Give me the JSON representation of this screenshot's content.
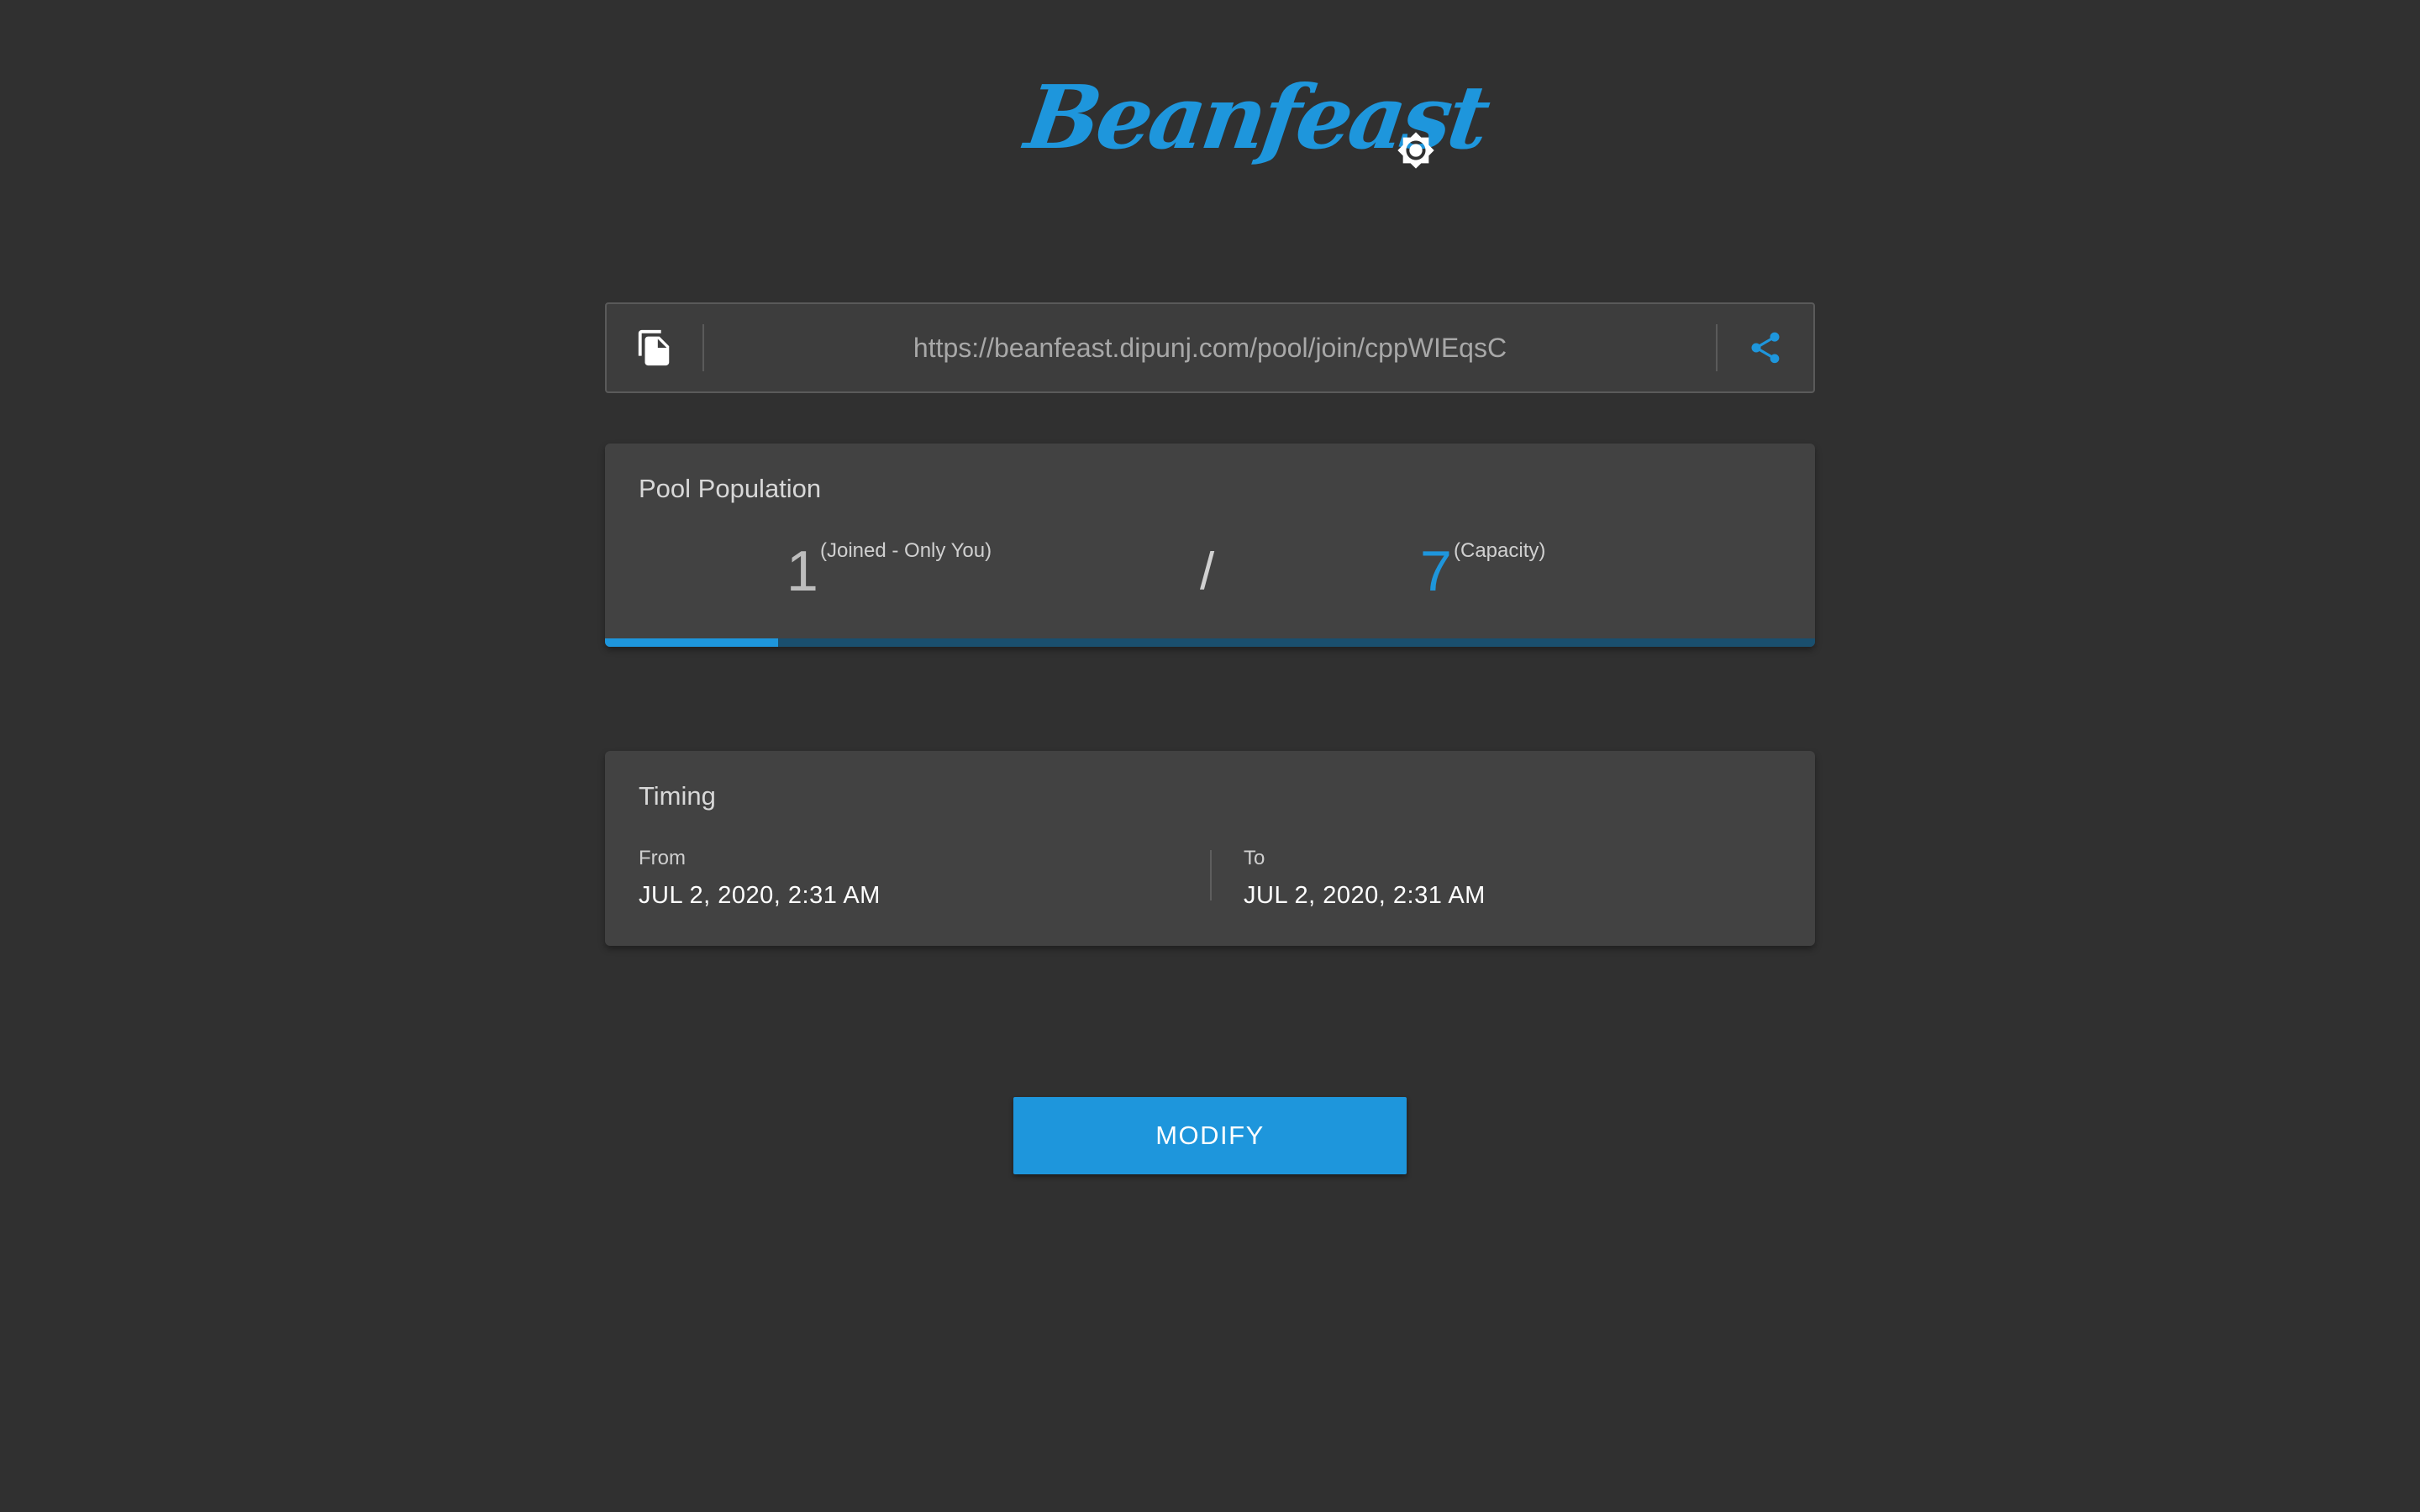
{
  "app": {
    "logo_text": "Beanfeast",
    "accent_color": "#1e96dc",
    "theme_toggle_icon": "brightness-icon"
  },
  "link_bar": {
    "url": "https://beanfeast.dipunj.com/pool/join/cppWIEqsC",
    "copy_icon": "copy-icon",
    "share_icon": "share-icon"
  },
  "population": {
    "title": "Pool Population",
    "joined_count": "1",
    "joined_label": "(Joined - Only You)",
    "separator": "/",
    "capacity_count": "7",
    "capacity_label": "(Capacity)",
    "progress_fraction": 0.143
  },
  "timing": {
    "title": "Timing",
    "from_label": "From",
    "from_value": "JUL 2, 2020, 2:31 AM",
    "to_label": "To",
    "to_value": "JUL 2, 2020, 2:31 AM"
  },
  "actions": {
    "modify_label": "MODIFY"
  }
}
